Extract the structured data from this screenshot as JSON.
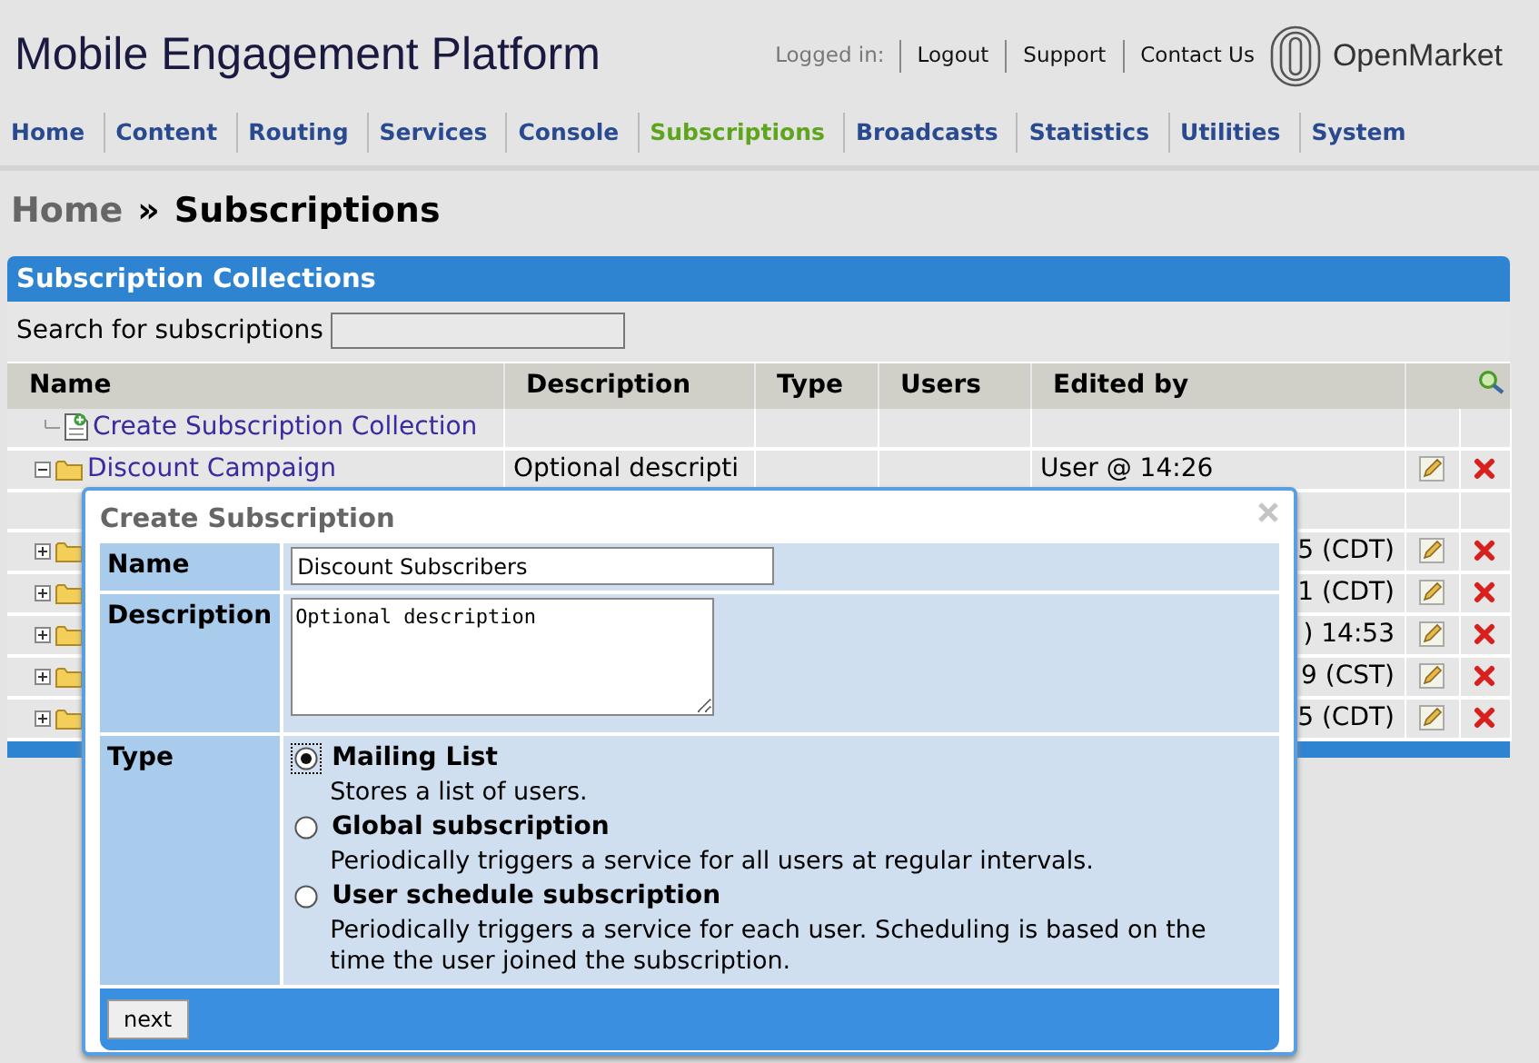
{
  "header": {
    "title": "Mobile Engagement Platform",
    "logged_in_label": "Logged in:",
    "links": [
      "Logout",
      "Support",
      "Contact Us"
    ],
    "logo_text": "OpenMarket"
  },
  "nav": [
    {
      "label": "Home",
      "selected": false
    },
    {
      "label": "Content",
      "selected": false
    },
    {
      "label": "Routing",
      "selected": false
    },
    {
      "label": "Services",
      "selected": false
    },
    {
      "label": "Console",
      "selected": false
    },
    {
      "label": "Subscriptions",
      "selected": true
    },
    {
      "label": "Broadcasts",
      "selected": false
    },
    {
      "label": "Statistics",
      "selected": false
    },
    {
      "label": "Utilities",
      "selected": false
    },
    {
      "label": "System",
      "selected": false
    }
  ],
  "breadcrumb": {
    "root": "Home",
    "separator": "»",
    "current": "Subscriptions"
  },
  "panel": {
    "title": "Subscription Collections",
    "search_label": "Search for subscriptions",
    "columns": [
      "Name",
      "Description",
      "Type",
      "Users",
      "Edited by"
    ],
    "rows": [
      {
        "kind": "create",
        "name": "Create Subscription Collection"
      },
      {
        "kind": "collection",
        "expanded": true,
        "name": "Discount Campaign",
        "description": "Optional descripti",
        "edited_by": "User @ 14:26"
      },
      {
        "kind": "child"
      },
      {
        "kind": "covered",
        "expanded": false,
        "edited_by": "5 (CDT)"
      },
      {
        "kind": "covered",
        "expanded": false,
        "edited_by": "1 (CDT)"
      },
      {
        "kind": "covered",
        "expanded": false,
        "edited_by": ") 14:53"
      },
      {
        "kind": "covered",
        "expanded": false,
        "edited_by": "9 (CST)"
      },
      {
        "kind": "covered",
        "expanded": false,
        "edited_by": "5 (CDT)"
      }
    ]
  },
  "dialog": {
    "title": "Create Subscription",
    "name_label": "Name",
    "name_value": "Discount Subscribers",
    "description_label": "Description",
    "description_value": "Optional description",
    "type_label": "Type",
    "types": [
      {
        "label": "Mailing List",
        "description": "Stores a list of users.",
        "selected": true
      },
      {
        "label": "Global subscription",
        "description": "Periodically triggers a service for all users at regular intervals.",
        "selected": false
      },
      {
        "label": "User schedule subscription",
        "description": "Periodically triggers a service for each user. Scheduling is based on the time the user joined the subscription.",
        "selected": false
      }
    ],
    "button": "next"
  }
}
